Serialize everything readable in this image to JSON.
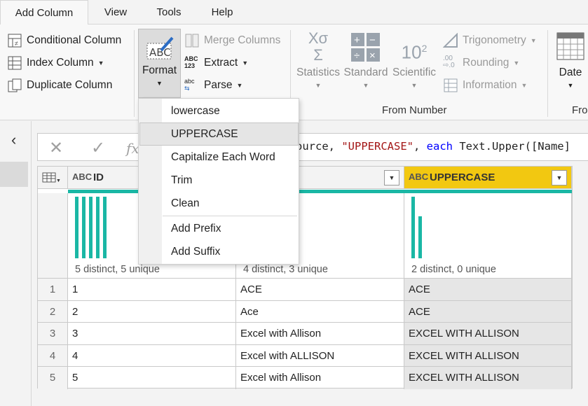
{
  "tabs": [
    {
      "label": "Add Column",
      "active": true
    },
    {
      "label": "View"
    },
    {
      "label": "Tools"
    },
    {
      "label": "Help"
    }
  ],
  "ribbon": {
    "general": {
      "conditional_column": "Conditional Column",
      "index_column": "Index Column",
      "duplicate_column": "Duplicate Column"
    },
    "text": {
      "format": "Format",
      "merge_columns": "Merge Columns",
      "extract": "Extract",
      "parse": "Parse"
    },
    "from_number": {
      "statistics": "Statistics",
      "standard": "Standard",
      "scientific": "Scientific",
      "trigonometry": "Trigonometry",
      "rounding": "Rounding",
      "information": "Information",
      "label": "From Number"
    },
    "date": {
      "date": "Date",
      "label_partial": "Fro"
    }
  },
  "format_menu": {
    "items": [
      "lowercase",
      "UPPERCASE",
      "Capitalize Each Word",
      "Trim",
      "Clean",
      "Add Prefix",
      "Add Suffix"
    ],
    "hovered": "UPPERCASE"
  },
  "formula": {
    "visible_prefix": "ource, ",
    "string_arg": "\"UPPERCASE\"",
    "sep": ", ",
    "keyword": "each",
    "rest": " Text.Upper([Name]"
  },
  "grid": {
    "columns": [
      {
        "type": "ABC",
        "name": "ID",
        "stat": "5 distinct, 5 unique",
        "bars": [
          1,
          1,
          1,
          1,
          1
        ]
      },
      {
        "type": "ABC",
        "name": "",
        "stat": "4 distinct, 3 unique",
        "bars": []
      },
      {
        "type": "ABC",
        "name": "UPPERCASE",
        "stat": "2 distinct, 0 unique",
        "bars": [
          1,
          0.5
        ]
      }
    ],
    "rows": [
      {
        "n": "1",
        "id": "1",
        "name": "ACE",
        "upper": "ACE"
      },
      {
        "n": "2",
        "id": "2",
        "name": "Ace",
        "upper": "ACE"
      },
      {
        "n": "3",
        "id": "3",
        "name": "Excel with Allison",
        "upper": "EXCEL WITH ALLISON"
      },
      {
        "n": "4",
        "id": "4",
        "name": "Excel with ALLISON",
        "upper": "EXCEL WITH ALLISON"
      },
      {
        "n": "5",
        "id": "5",
        "name": "Excel with Allison",
        "upper": "EXCEL WITH ALLISON"
      }
    ]
  },
  "colors": {
    "accent_teal": "#1ab7a5",
    "selected_column": "#f2c811",
    "formula_string": "#a31515",
    "formula_keyword": "#0000ff"
  }
}
